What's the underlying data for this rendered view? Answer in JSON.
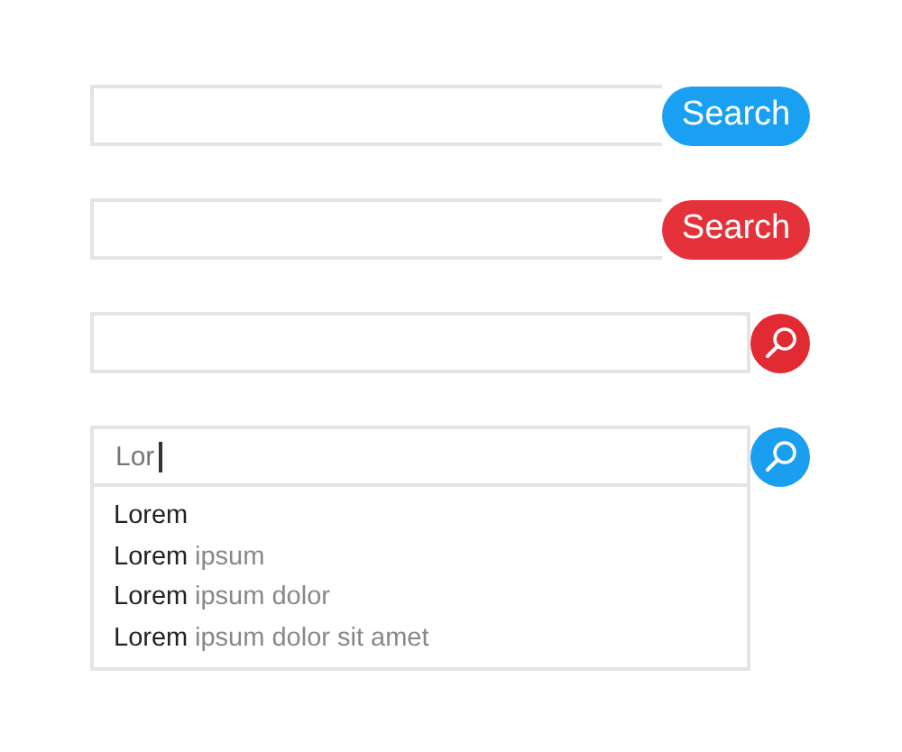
{
  "search_bars": [
    {
      "kind": "pill",
      "color": "#1aa0f2",
      "button_label": "Search"
    },
    {
      "kind": "pill",
      "color": "#e5323a",
      "button_label": "Search"
    },
    {
      "kind": "round",
      "color": "#e12a31"
    },
    {
      "kind": "round",
      "color": "#1a9ef0",
      "value": "Lor",
      "focused": true,
      "suggestions": [
        {
          "match": "Lorem"
        },
        {
          "match": "Lorem",
          "rest": "ipsum"
        },
        {
          "match": "Lorem",
          "rest": "ipsum dolor"
        },
        {
          "match": "Lorem",
          "rest": "ipsum dolor sit amet"
        }
      ]
    }
  ]
}
